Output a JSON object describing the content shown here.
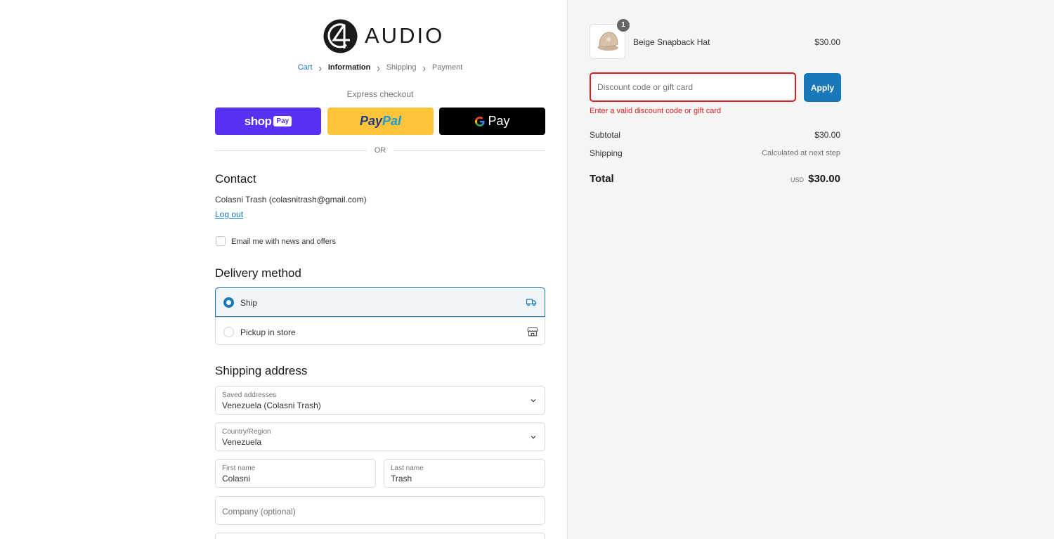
{
  "header": {
    "logo_text": "AUDIO",
    "breadcrumb": {
      "cart": "Cart",
      "information": "Information",
      "shipping": "Shipping",
      "payment": "Payment"
    }
  },
  "express": {
    "label": "Express checkout",
    "shop_pay_word": "shop",
    "shop_pay_chip": "Pay",
    "paypal_pay": "Pay",
    "paypal_pal": "Pal",
    "gpay_g": "G",
    "gpay_text": "Pay",
    "or_text": "OR"
  },
  "contact": {
    "heading": "Contact",
    "user_line": "Colasni Trash (colasnitrash@gmail.com)",
    "logout": "Log out",
    "newsletter_label": "Email me with news and offers",
    "newsletter_checked": false
  },
  "delivery": {
    "heading": "Delivery method",
    "options": [
      {
        "label": "Ship",
        "icon": "truck-icon",
        "selected": true
      },
      {
        "label": "Pickup in store",
        "icon": "store-icon",
        "selected": false
      }
    ]
  },
  "shipping_address": {
    "heading": "Shipping address",
    "saved_label": "Saved addresses",
    "saved_value": "Venezuela (Colasni Trash)",
    "country_label": "Country/Region",
    "country_value": "Venezuela",
    "first_name_label": "First name",
    "first_name_value": "Colasni",
    "last_name_label": "Last name",
    "last_name_value": "Trash",
    "company_placeholder": "Company (optional)"
  },
  "order_summary": {
    "item": {
      "name": "Beige Snapback Hat",
      "price": "$30.00",
      "quantity": "1"
    },
    "discount_placeholder": "Discount code or gift card",
    "apply_label": "Apply",
    "discount_error": "Enter a valid discount code or gift card",
    "subtotal_label": "Subtotal",
    "subtotal_value": "$30.00",
    "shipping_label": "Shipping",
    "shipping_value": "Calculated at next step",
    "total_label": "Total",
    "currency": "USD",
    "total_value": "$30.00"
  },
  "colors": {
    "accent": "#1878b9",
    "error": "#dd1d1d",
    "shop_pay": "#5a31f4",
    "paypal": "#ffc439",
    "gpay": "#000000"
  }
}
